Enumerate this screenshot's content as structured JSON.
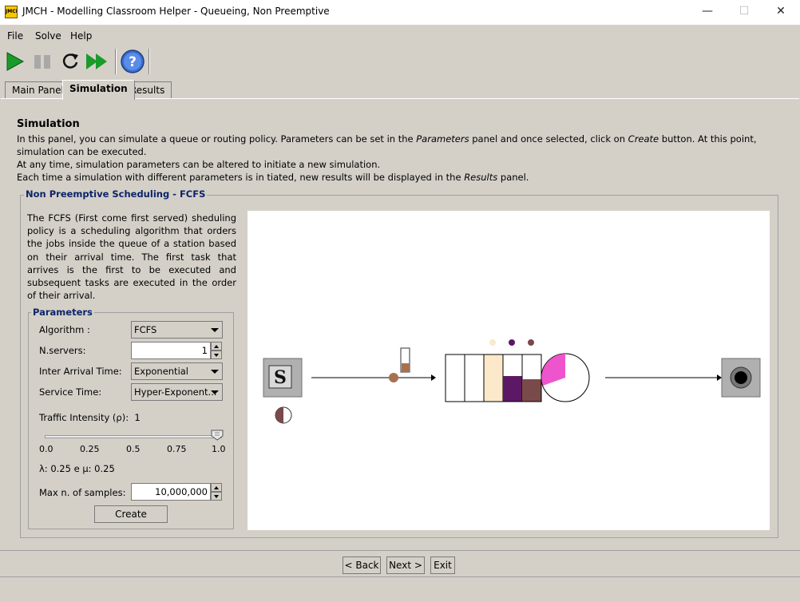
{
  "window": {
    "title": "JMCH - Modelling Classroom Helper - Queueing, Non Preemptive",
    "icon_text": "JMCH",
    "minimize": "—",
    "maximize": "☐",
    "close": "✕"
  },
  "menu": {
    "file": "File",
    "solve": "Solve",
    "help": "Help"
  },
  "toolbar": {
    "icons": [
      "play-icon",
      "pause-icon",
      "reset-icon",
      "fast-forward-icon",
      "help-icon"
    ]
  },
  "tabs": {
    "main": "Main Panel",
    "simulation": "Simulation",
    "results": "Results"
  },
  "intro": {
    "heading": "Simulation",
    "line1_a": "In this panel, you can simulate a queue or routing policy. Parameters can be set in the ",
    "line1_b": "Parameters",
    "line1_c": " panel and once selected, click on ",
    "line1_d": "Create",
    "line1_e": " button. At this point, simulation can be executed.",
    "line2": "At any time, simulation parameters can be altered to initiate a new simulation.",
    "line3_a": "Each time a simulation with different parameters is in tiated, new results will be displayed in the ",
    "line3_b": "Results",
    "line3_c": " panel."
  },
  "group": {
    "title": "Non Preemptive Scheduling - FCFS",
    "description": "The FCFS (First come first served) sheduling policy is a scheduling algorithm that orders the jobs inside the queue of a station based on their arrival time. The first task that arrives is the first to be executed and subsequent tasks are executed in the order of their arrival."
  },
  "params": {
    "title": "Parameters",
    "algorithm_label": "Algorithm :",
    "algorithm_value": "FCFS",
    "servers_label": "N.servers:",
    "servers_value": "1",
    "arrival_label": "Inter Arrival Time:",
    "arrival_value": "Exponential",
    "service_label": "Service Time:",
    "service_value": "Hyper-Exponent...",
    "traffic_label": "Traffic Intensity (ρ):",
    "traffic_value": "1",
    "traffic_level": 1.0,
    "ticks": [
      "0.0",
      "0.25",
      "0.5",
      "0.75",
      "1.0"
    ],
    "lambda_mu": "λ: 0.25 e μ: 0.25",
    "samples_label": "Max n. of samples:",
    "samples_value": "10,000,000",
    "create": "Create"
  },
  "sim": {
    "source_label": "S",
    "queue_cells": [
      "#ffffff",
      "#ffffff",
      "#fbe9c9",
      "#5c1864",
      "#7a4a4a"
    ],
    "waiting_dots": [
      "#fbe9c9",
      "#5c1864",
      "#7a4a4a"
    ],
    "server_color": "#ee55cc",
    "arrival_color": "#a87050"
  },
  "nav": {
    "back": "< Back",
    "next": "Next >",
    "exit": "Exit"
  }
}
